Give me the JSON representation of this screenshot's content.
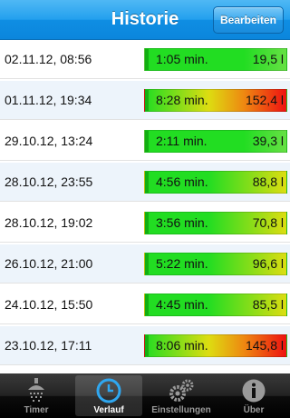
{
  "navbar": {
    "title": "Historie",
    "edit_label": "Bearbeiten"
  },
  "rows": [
    {
      "date": "02.11.12, 08:56",
      "duration": "1:05 min.",
      "volume": "19,5 l",
      "level": 0.13
    },
    {
      "date": "01.11.12, 19:34",
      "duration": "8:28 min.",
      "volume": "152,4 l",
      "level": 1.0
    },
    {
      "date": "29.10.12, 13:24",
      "duration": "2:11 min.",
      "volume": "39,3 l",
      "level": 0.26
    },
    {
      "date": "28.10.12, 23:55",
      "duration": "4:56 min.",
      "volume": "88,8 l",
      "level": 0.58
    },
    {
      "date": "28.10.12, 19:02",
      "duration": "3:56 min.",
      "volume": "70,8 l",
      "level": 0.46
    },
    {
      "date": "26.10.12, 21:00",
      "duration": "5:22 min.",
      "volume": "96,6 l",
      "level": 0.63
    },
    {
      "date": "24.10.12, 15:50",
      "duration": "4:45 min.",
      "volume": "85,5 l",
      "level": 0.56
    },
    {
      "date": "23.10.12, 17:11",
      "duration": "8:06 min.",
      "volume": "145,8 l",
      "level": 0.96
    },
    {
      "date": "",
      "duration": "",
      "volume": "",
      "level": 0.5
    }
  ],
  "tabs": [
    {
      "label": "Timer",
      "icon": "shower-icon",
      "active": false
    },
    {
      "label": "Verlauf",
      "icon": "clock-icon",
      "active": true
    },
    {
      "label": "Einstellungen",
      "icon": "gears-icon",
      "active": false
    },
    {
      "label": "Über",
      "icon": "info-icon",
      "active": false
    }
  ],
  "colors": {
    "low": "#22dd22",
    "mid": "#dddd11",
    "high": "#ee1111"
  }
}
